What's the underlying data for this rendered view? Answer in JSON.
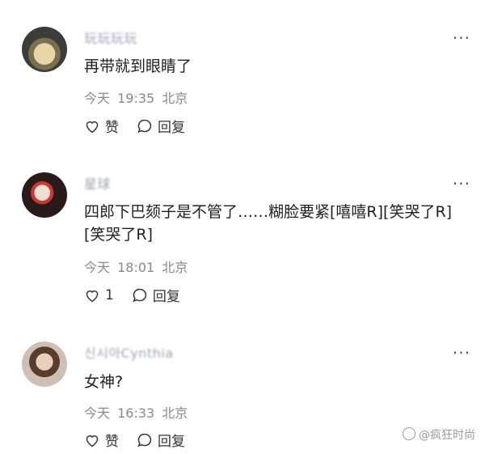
{
  "comments": [
    {
      "username": "玩玩玩玩",
      "text": "再带就到眼睛了",
      "time": "今天 19:35",
      "location": "北京",
      "like_label": "赞",
      "reply_label": "回复"
    },
    {
      "username": "星球",
      "text": "四郎下巴颏子是不管了……糊脸要紧[嘻嘻R][笑哭了R][笑哭了R]",
      "time": "今天 18:01",
      "location": "北京",
      "like_label": "1",
      "reply_label": "回复"
    },
    {
      "username": "신시아Cynthia",
      "text": "女神?",
      "time": "今天 16:33",
      "location": "北京",
      "like_label": "赞",
      "reply_label": "回复"
    }
  ],
  "more_label": "···",
  "watermark": "@疯狂时尚"
}
